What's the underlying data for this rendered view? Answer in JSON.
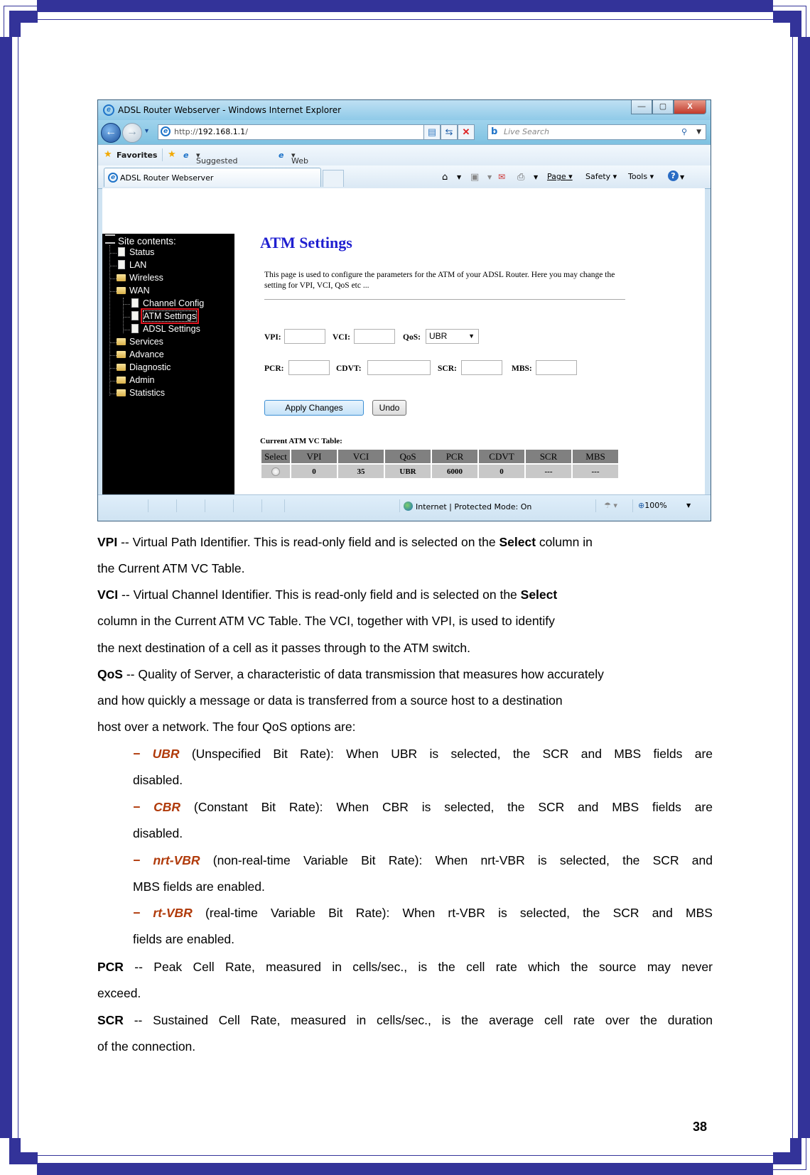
{
  "browser": {
    "window_title": "ADSL Router Webserver - Windows Internet Explorer",
    "address_prefix": "http://",
    "address_host": "192.168.1.1",
    "address_suffix": "/",
    "search_placeholder": "Live Search",
    "favorites_label": "Favorites",
    "suggested_sites_label": "Suggested Sites",
    "web_slice_label": "Web Slice Gallery",
    "tab_label": "ADSL Router Webserver",
    "command_bar": {
      "page": "Page",
      "safety": "Safety",
      "tools": "Tools"
    },
    "status_zone": "Internet | Protected Mode: On",
    "zoom_level": "100%"
  },
  "sidebar": {
    "title": "Site contents:",
    "items": [
      {
        "label": "Status",
        "type": "document",
        "level": 1
      },
      {
        "label": "LAN",
        "type": "document",
        "level": 1
      },
      {
        "label": "Wireless",
        "type": "folder",
        "level": 1
      },
      {
        "label": "WAN",
        "type": "folder-open",
        "level": 1
      },
      {
        "label": "Channel Config",
        "type": "document",
        "level": 2
      },
      {
        "label": "ATM Settings",
        "type": "document",
        "level": 2,
        "selected": true
      },
      {
        "label": "ADSL Settings",
        "type": "document",
        "level": 2
      },
      {
        "label": "Services",
        "type": "folder",
        "level": 1
      },
      {
        "label": "Advance",
        "type": "folder",
        "level": 1
      },
      {
        "label": "Diagnostic",
        "type": "folder",
        "level": 1
      },
      {
        "label": "Admin",
        "type": "folder",
        "level": 1
      },
      {
        "label": "Statistics",
        "type": "folder",
        "level": 1
      }
    ]
  },
  "atm": {
    "title": "ATM Settings",
    "description": "This page is used to configure the parameters for the ATM of your ADSL Router. Here you may change the setting for VPI, VCI, QoS etc ...",
    "labels": {
      "vpi": "VPI:",
      "vci": "VCI:",
      "qos": "QoS:",
      "pcr": "PCR:",
      "cdvt": "CDVT:",
      "scr": "SCR:",
      "mbs": "MBS:"
    },
    "values": {
      "vpi": "",
      "vci": "",
      "pcr": "",
      "cdvt": "",
      "scr": "",
      "mbs": ""
    },
    "qos_selected": "UBR",
    "apply_label": "Apply Changes",
    "undo_label": "Undo",
    "table_title": "Current ATM VC Table:",
    "table_headers": [
      "Select",
      "VPI",
      "VCI",
      "QoS",
      "PCR",
      "CDVT",
      "SCR",
      "MBS"
    ],
    "table_rows": [
      {
        "vpi": "0",
        "vci": "35",
        "qos": "UBR",
        "pcr": "6000",
        "cdvt": "0",
        "scr": "---",
        "mbs": "---"
      }
    ]
  },
  "doc": {
    "vpi_term": "VPI",
    "vpi_text1": " -- Virtual Path Identifier. This is read-only field and is selected on the ",
    "vpi_bold": "Select",
    "vpi_text2": " column in",
    "vpi_line2": "the Current ATM VC Table.",
    "vci_term": "VCI",
    "vci_text1": " -- Virtual Channel Identifier. This is read-only field and is selected on the ",
    "vci_bold": "Select",
    "vci_line2": "column in the Current ATM VC Table. The VCI, together with VPI, is used to identify",
    "vci_line3": "the next destination of a cell as it passes through to the ATM switch.",
    "qos_term": "QoS",
    "qos_text1": " -- Quality of Server, a characteristic of data transmission that measures how accurately",
    "qos_line2": "and how quickly a message or data is transferred from a source host to a destination",
    "qos_line3": "host over a network. The four QoS options are:",
    "options": [
      {
        "term": "UBR",
        "text": " (Unspecified Bit Rate): When UBR is selected, the SCR and MBS fields are",
        "cont": "disabled."
      },
      {
        "term": "CBR",
        "text": " (Constant Bit Rate): When CBR is selected, the SCR and MBS fields are",
        "cont": "disabled."
      },
      {
        "term": "nrt-VBR",
        "text": " (non-real-time Variable Bit Rate): When nrt-VBR is selected, the SCR and",
        "cont": "MBS fields are enabled."
      },
      {
        "term": "rt-VBR",
        "text": " (real-time Variable Bit Rate): When rt-VBR is selected, the SCR and MBS",
        "cont": "fields are enabled."
      }
    ],
    "bullet": "−",
    "pcr_term": "PCR",
    "pcr_text": " -- Peak Cell Rate, measured in cells/sec., is the cell rate which the source may never",
    "pcr_line2": "exceed.",
    "scr_term": "SCR",
    "scr_text": " -- Sustained Cell Rate, measured in cells/sec., is the average cell rate over the duration",
    "scr_line2": "of the connection."
  },
  "page_number": "38",
  "colors": {
    "frame": "#333399",
    "term": "#b03a0a",
    "heading": "#1f1fd0"
  }
}
